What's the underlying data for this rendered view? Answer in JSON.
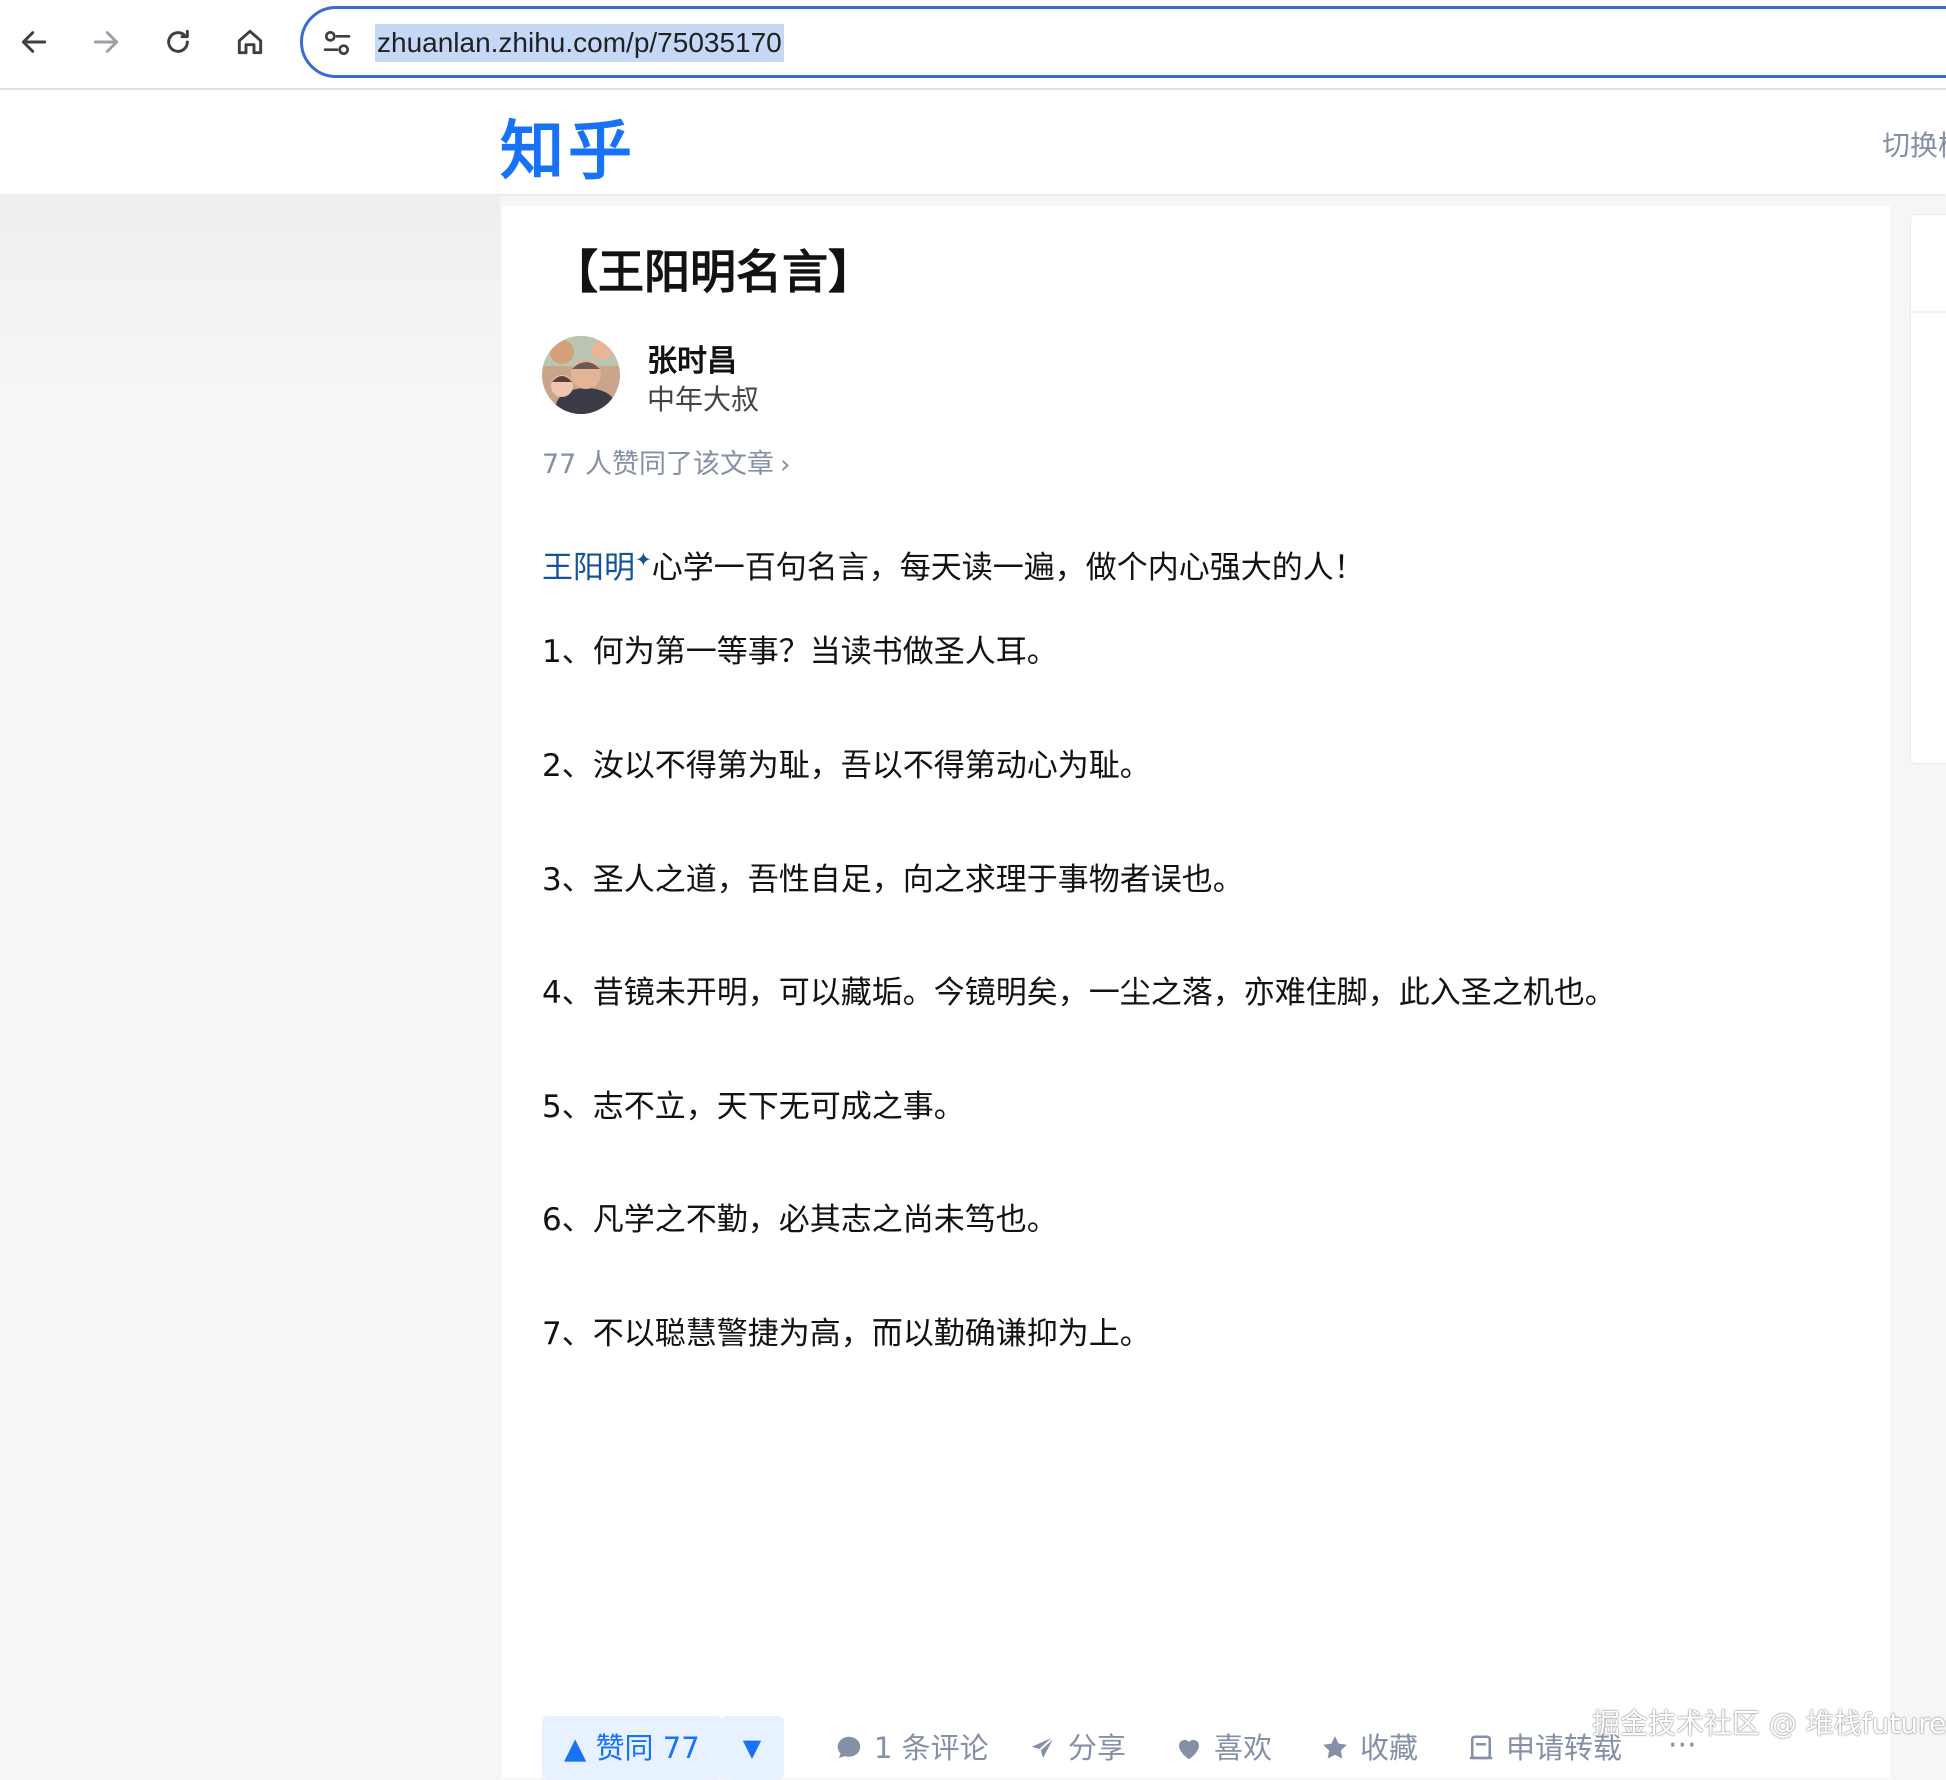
{
  "browser": {
    "url": "zhuanlan.zhihu.com/p/75035170"
  },
  "header": {
    "logo": "知乎",
    "switch_theme": "切换模式"
  },
  "article": {
    "title": "【王阳明名言】",
    "author": {
      "name": "张时昌",
      "bio": "中年大叔"
    },
    "voters_text": "77 人赞同了该文章",
    "intro_link": "王阳明",
    "intro_rest": "心学一百句名言，每天读一遍，做个内心强大的人！",
    "quotes": [
      "1、何为第一等事？当读书做圣人耳。",
      "2、汝以不得第为耻，吾以不得第动心为耻。",
      "3、圣人之道，吾性自足，向之求理于事物者误也。",
      "4、昔镜未开明，可以藏垢。今镜明矣，一尘之落，亦难住脚，此入圣之机也。",
      "5、志不立，天下无可成之事。",
      "6、凡学之不勤，必其志之尚未笃也。",
      "7、不以聪慧警捷为高，而以勤确谦抑为上。"
    ]
  },
  "actions": {
    "vote_up": "▲ 赞同 77",
    "vote_down": "▼",
    "comment": "1 条评论",
    "share": "分享",
    "like": "喜欢",
    "collect": "收藏",
    "repost": "申请转载",
    "more": "···"
  },
  "watermark": "掘金技术社区 @ 堆栈future",
  "colors": {
    "brand": "#1772f6",
    "link": "#175199",
    "muted": "#8590a6"
  }
}
